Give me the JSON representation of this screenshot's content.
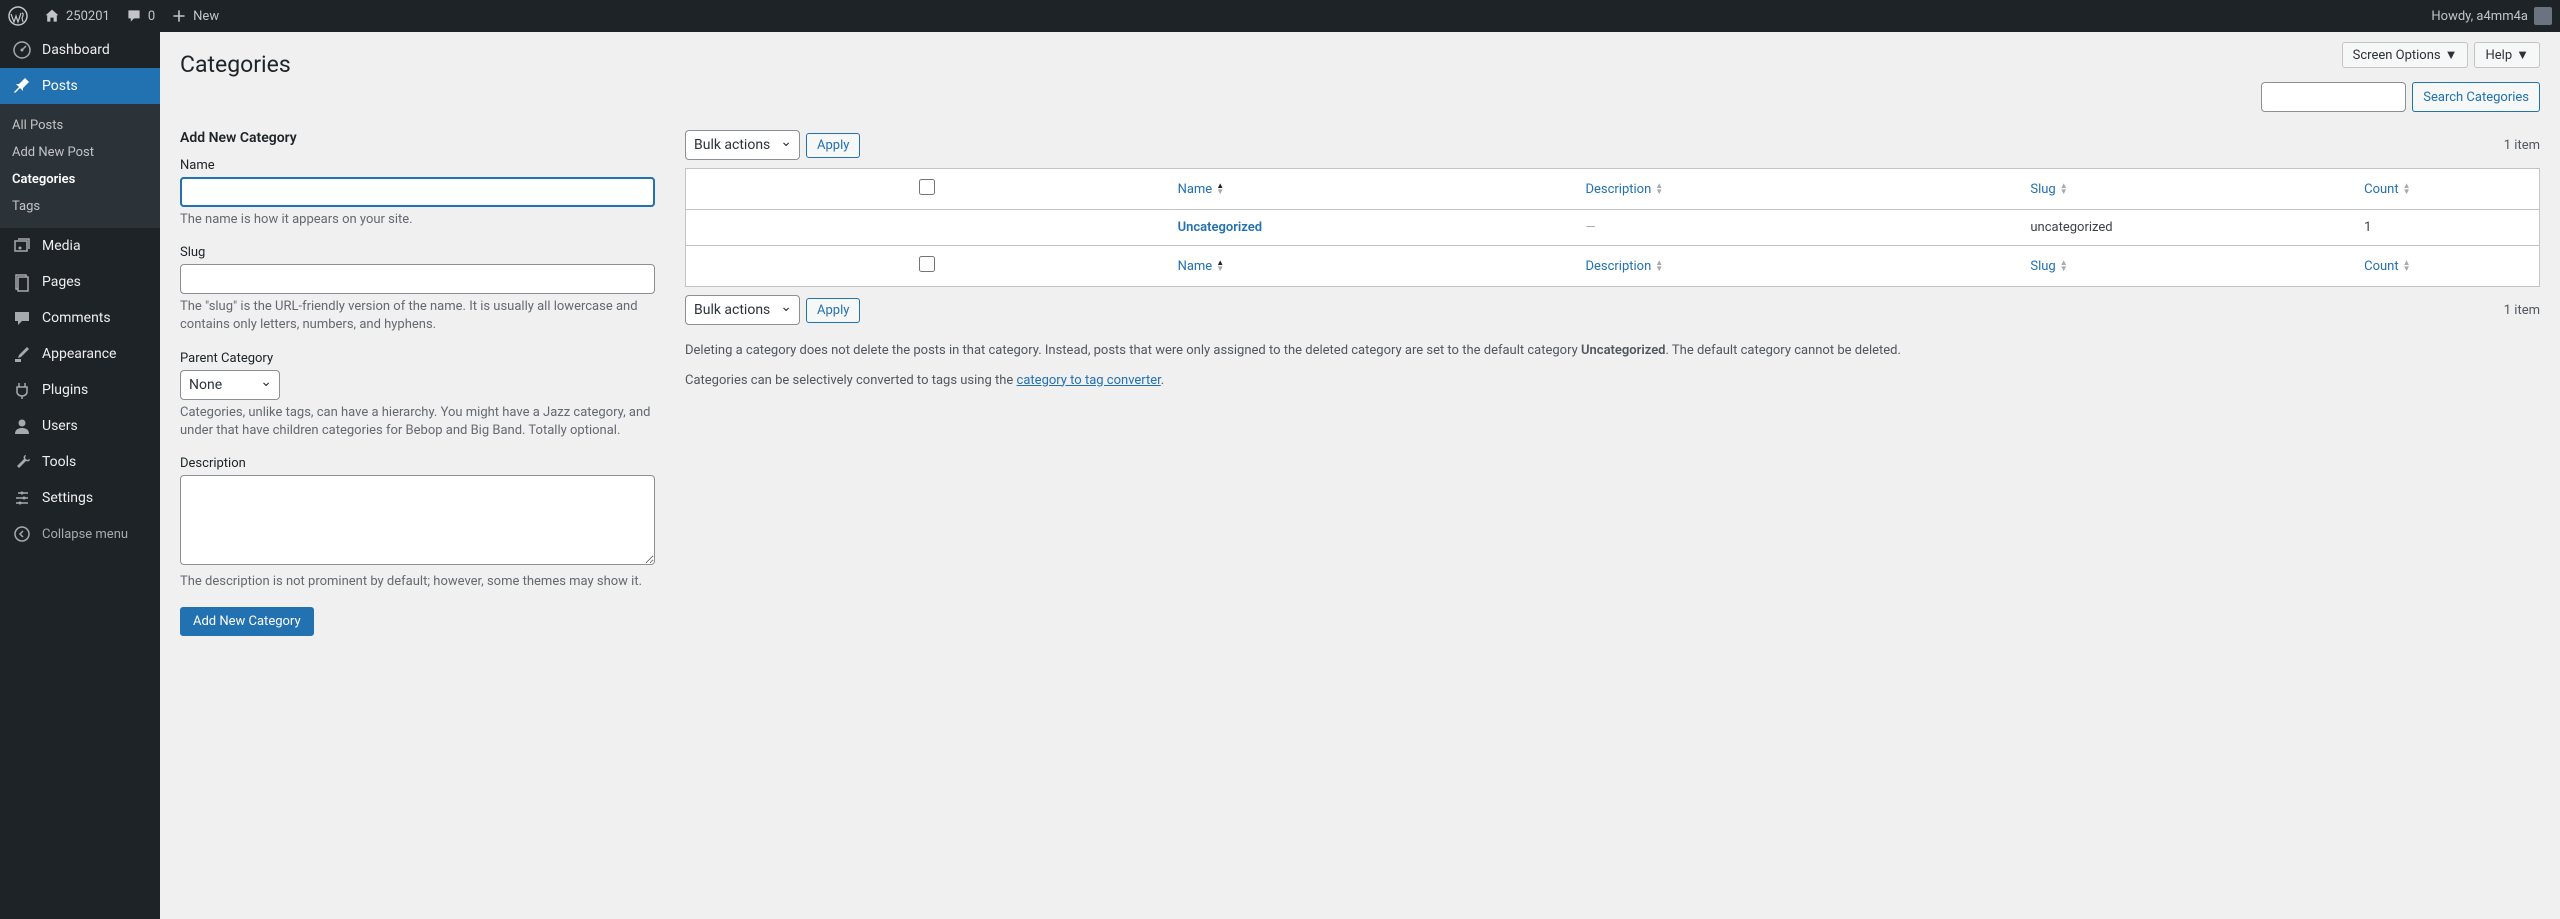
{
  "toolbar": {
    "site_name": "250201",
    "comments_count": "0",
    "new_label": "New",
    "howdy": "Howdy, a4mm4a"
  },
  "sidebar": {
    "items": [
      {
        "label": "Dashboard"
      },
      {
        "label": "Posts"
      },
      {
        "label": "Media"
      },
      {
        "label": "Pages"
      },
      {
        "label": "Comments"
      },
      {
        "label": "Appearance"
      },
      {
        "label": "Plugins"
      },
      {
        "label": "Users"
      },
      {
        "label": "Tools"
      },
      {
        "label": "Settings"
      }
    ],
    "submenu": [
      {
        "label": "All Posts"
      },
      {
        "label": "Add New Post"
      },
      {
        "label": "Categories"
      },
      {
        "label": "Tags"
      }
    ],
    "collapse": "Collapse menu"
  },
  "header": {
    "page_title": "Categories",
    "screen_options": "Screen Options",
    "help": "Help"
  },
  "form": {
    "heading": "Add New Category",
    "name_label": "Name",
    "name_help": "The name is how it appears on your site.",
    "slug_label": "Slug",
    "slug_help": "The \"slug\" is the URL-friendly version of the name. It is usually all lowercase and contains only letters, numbers, and hyphens.",
    "parent_label": "Parent Category",
    "parent_option": "None",
    "parent_help": "Categories, unlike tags, can have a hierarchy. You might have a Jazz category, and under that have children categories for Bebop and Big Band. Totally optional.",
    "desc_label": "Description",
    "desc_help": "The description is not prominent by default; however, some themes may show it.",
    "submit": "Add New Category"
  },
  "list": {
    "search_button": "Search Categories",
    "bulk_label": "Bulk actions",
    "apply": "Apply",
    "item_count": "1 item",
    "cols": {
      "name": "Name",
      "description": "Description",
      "slug": "Slug",
      "count": "Count"
    },
    "rows": [
      {
        "name": "Uncategorized",
        "description": "—",
        "slug": "uncategorized",
        "count": "1"
      }
    ],
    "info1a": "Deleting a category does not delete the posts in that category. Instead, posts that were only assigned to the deleted category are set to the default category ",
    "info1b": "Uncategorized",
    "info1c": ". The default category cannot be deleted.",
    "info2a": "Categories can be selectively converted to tags using the ",
    "info2b": "category to tag converter",
    "info2c": "."
  }
}
